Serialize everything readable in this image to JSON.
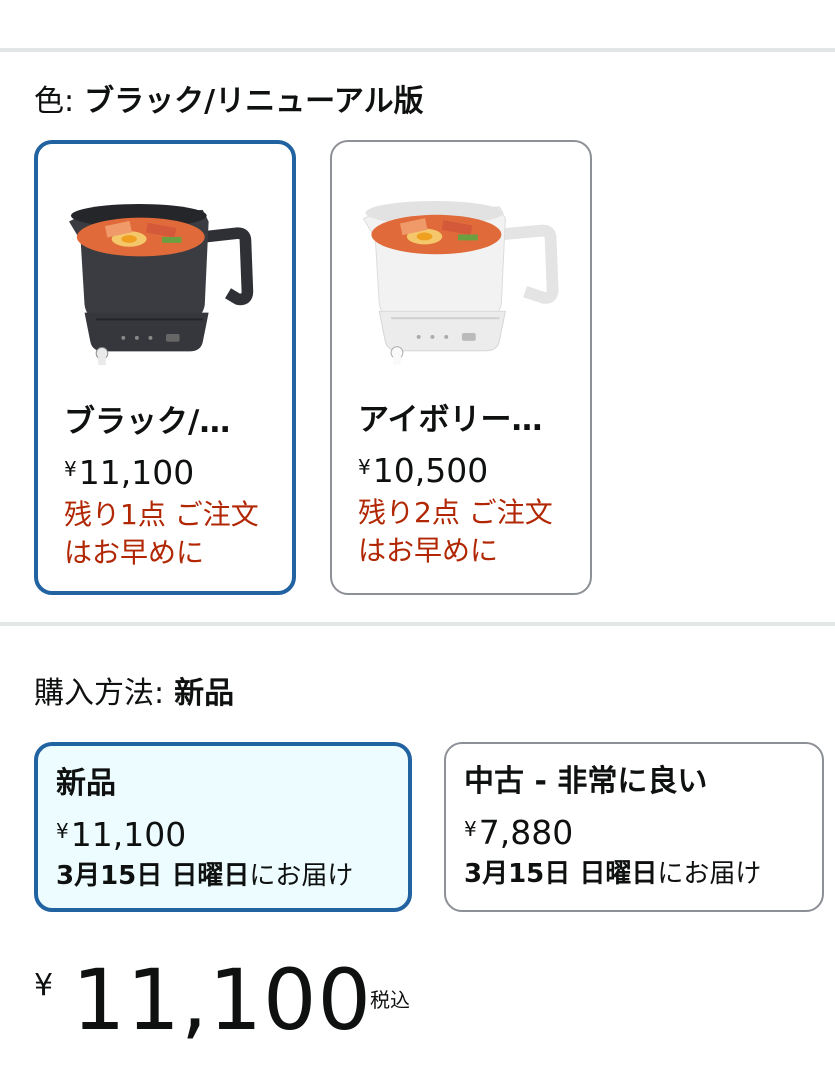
{
  "color_selector": {
    "label": "色:",
    "selected_value": "ブラック/リニューアル版",
    "options": [
      {
        "name": "ブラック/…",
        "currency": "¥",
        "price": "11,100",
        "stock_note": "残り1点 ご注文はお早めに",
        "selected": true
      },
      {
        "name": "アイボリー…",
        "currency": "¥",
        "price": "10,500",
        "stock_note": "残り2点 ご注文はお早めに",
        "selected": false
      }
    ]
  },
  "purchase_method": {
    "label": "購入方法:",
    "selected_value": "新品",
    "options": [
      {
        "title": "新品",
        "currency": "¥",
        "price": "11,100",
        "delivery_date": "3月15日 日曜日",
        "delivery_suffix": "にお届け",
        "selected": true
      },
      {
        "title": "中古 - 非常に良い",
        "currency": "¥",
        "price": "7,880",
        "delivery_date": "3月15日 日曜日",
        "delivery_suffix": "にお届け",
        "selected": false
      }
    ]
  },
  "price_display": {
    "currency": "¥",
    "amount": "11,100",
    "tax_note": "税込"
  },
  "colors": {
    "selected_border": "#2162a1",
    "stock_red": "#b12704",
    "selected_bg": "#edfdff"
  }
}
